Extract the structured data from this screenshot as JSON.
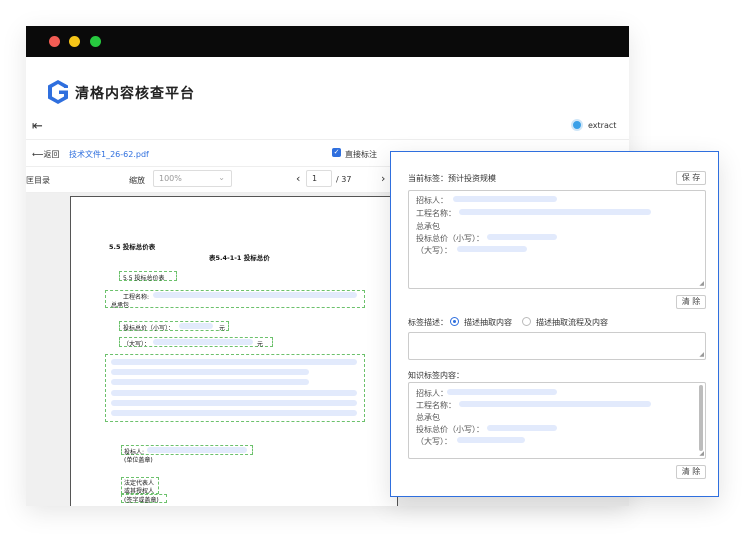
{
  "window": {
    "title_bar": {
      "dots": [
        "#f25c54",
        "#f5c518",
        "#27c93f"
      ]
    },
    "app_title": "清格内容核查平台",
    "menu_icon": "menu-collapse-icon",
    "user": {
      "name": "extract",
      "avatar_icon": "avatar-icon"
    }
  },
  "toolbar": {
    "back_label": "⟵返回",
    "file_name": "技术文件1_26-62.pdf",
    "direct_mark_label": "直接标注"
  },
  "viewbar": {
    "toc_label": "匡目录",
    "zoom_label": "缩放",
    "zoom_value": "100%",
    "page_current": "1",
    "page_total": "/ 37"
  },
  "document": {
    "heading": "5.5 投标总价表",
    "table_title": "表5.4-1-1 投标总价",
    "section_title": "5.5 投标总价表",
    "project_name_label": "工程名称:",
    "general_contract": "总承包",
    "total_small_label": "投标总价（小写）：",
    "total_small_unit": "元",
    "total_big_label": "（大写）：",
    "total_big_unit": "元",
    "bidder_label": "投标人:",
    "bidder_seal": "(单位盖章)",
    "rep_line1": "法定代表人",
    "rep_line2": "或其授权人",
    "rep_line3": "(签字或盖章)"
  },
  "panel": {
    "current_tag_label": "当前标签：预计投资规模",
    "save_button": "保 存",
    "extract_lines": [
      "招标人：",
      "工程名称：",
      "总承包",
      "投标总价（小写）：",
      "（大写）："
    ],
    "clear_button_1": "清 除",
    "tag_desc_label": "标签描述：",
    "radio_option_1": "描述抽取内容",
    "radio_option_2": "描述抽取流程及内容",
    "knowledge_label": "知识标签内容：",
    "knowledge_lines": [
      "招标人：",
      "工程名称：",
      "总承包",
      "投标总价（小写）：",
      "（大写）："
    ],
    "clear_button_2": "清 除"
  },
  "colors": {
    "accent": "#2f6fde",
    "highlight": "#e2eafc",
    "annotation": "#6cc16c"
  }
}
